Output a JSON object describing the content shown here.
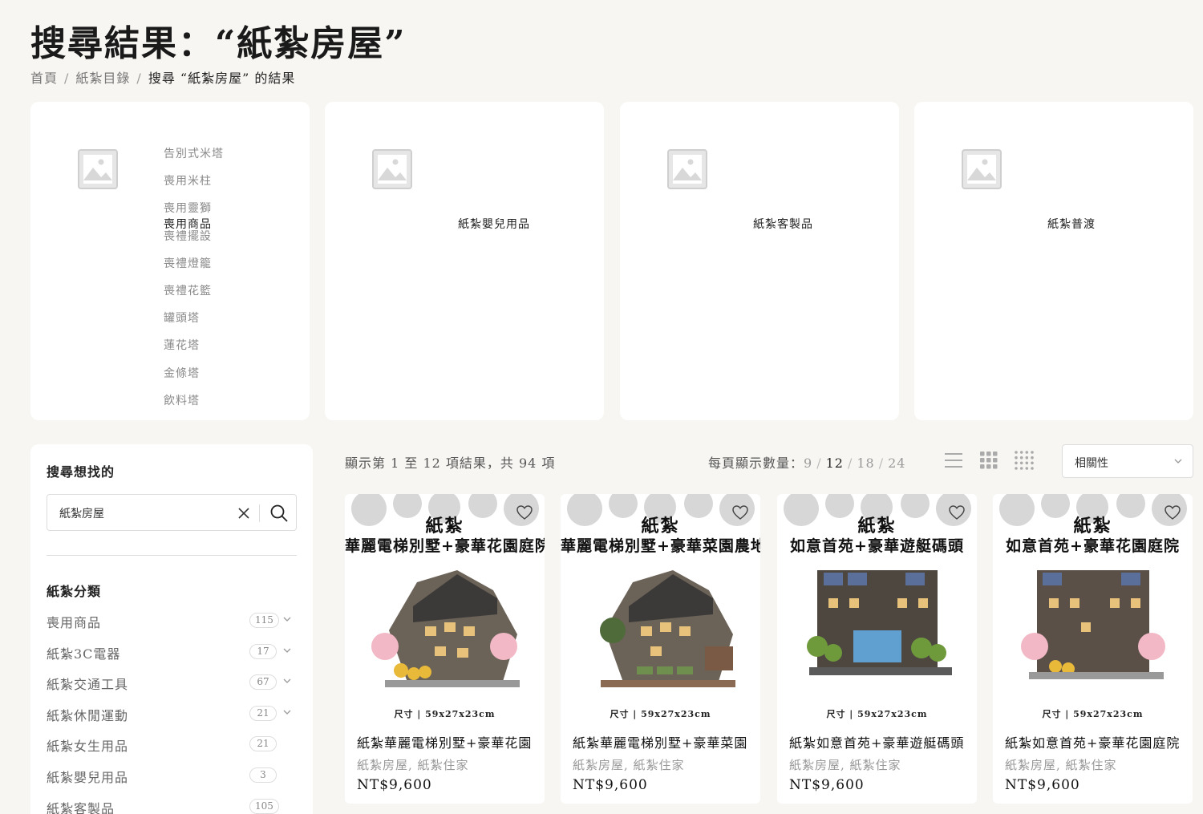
{
  "header": {
    "title": "搜尋結果：“紙紮房屋”",
    "breadcrumb": [
      "首頁",
      "紙紮目錄",
      "搜尋 “紙紮房屋” 的結果"
    ]
  },
  "category_cards": [
    {
      "title": "喪用商品",
      "subcategories": [
        "告別式米塔",
        "喪用米柱",
        "喪用靈獅",
        "喪禮擺設",
        "喪禮燈籠",
        "喪禮花籃",
        "罐頭塔",
        "蓮花塔",
        "金條塔",
        "飲料塔"
      ]
    },
    {
      "title": "紙紮嬰兒用品",
      "subcategories": []
    },
    {
      "title": "紙紮客製品",
      "subcategories": []
    },
    {
      "title": "紙紮普渡",
      "subcategories": []
    }
  ],
  "sidebar": {
    "search_title": "搜尋想找的",
    "search_value": "紙紮房屋",
    "category_heading": "紙紮分類",
    "filters": [
      {
        "label": "喪用商品",
        "count": "115",
        "expandable": true
      },
      {
        "label": "紙紮3C電器",
        "count": "17",
        "expandable": true
      },
      {
        "label": "紙紮交通工具",
        "count": "67",
        "expandable": true
      },
      {
        "label": "紙紮休閒運動",
        "count": "21",
        "expandable": true
      },
      {
        "label": "紙紮女生用品",
        "count": "21",
        "expandable": false
      },
      {
        "label": "紙紮嬰兒用品",
        "count": "3",
        "expandable": false
      },
      {
        "label": "紙紮客製品",
        "count": "105",
        "expandable": false
      }
    ]
  },
  "toolbar": {
    "result_count": "顯示第 1 至 12 項結果，共 94 項",
    "per_page_label": "每頁顯示數量：",
    "per_page_options": [
      "9",
      "12",
      "18",
      "24"
    ],
    "per_page_active": "12",
    "sort_value": "相關性"
  },
  "products": [
    {
      "brand": "紙紮",
      "headline": "華麗電梯別墅+豪華花園庭院",
      "size": "尺寸 | 59x27x23cm",
      "name": "紙紮華麗電梯別墅+豪華花園",
      "categories": "紙紮房屋, 紙紮住家",
      "price": "NT$9,600"
    },
    {
      "brand": "紙紮",
      "headline": "華麗電梯別墅+豪華菜園農地",
      "size": "尺寸 | 59x27x23cm",
      "name": "紙紮華麗電梯別墅+豪華菜園",
      "categories": "紙紮房屋, 紙紮住家",
      "price": "NT$9,600"
    },
    {
      "brand": "紙紮",
      "headline": "如意首苑+豪華遊艇碼頭",
      "size": "尺寸 | 59x27x23cm",
      "name": "紙紮如意首苑+豪華遊艇碼頭",
      "categories": "紙紮房屋, 紙紮住家",
      "price": "NT$9,600"
    },
    {
      "brand": "紙紮",
      "headline": "如意首苑+豪華花園庭院",
      "size": "尺寸 | 59x27x23cm",
      "name": "紙紮如意首苑+豪華花園庭院",
      "categories": "紙紮房屋, 紙紮住家",
      "price": "NT$9,600"
    }
  ]
}
